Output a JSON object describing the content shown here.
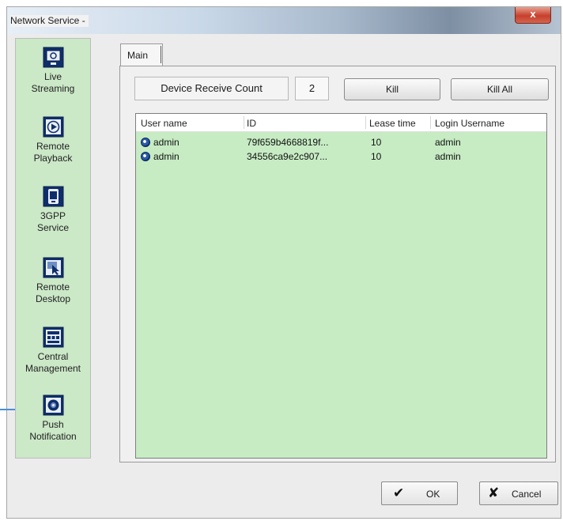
{
  "window": {
    "title": "Network Service -",
    "close_label": "x"
  },
  "sidebar": {
    "items": [
      {
        "label_1": "Live",
        "label_2": "Streaming",
        "icon": "monitor-icon"
      },
      {
        "label_1": "Remote",
        "label_2": "Playback",
        "icon": "play-icon"
      },
      {
        "label_1": "3GPP",
        "label_2": "Service",
        "icon": "phone-icon"
      },
      {
        "label_1": "Remote",
        "label_2": "Desktop",
        "icon": "desktop-cursor-icon"
      },
      {
        "label_1": "Central",
        "label_2": "Management",
        "icon": "management-icon"
      },
      {
        "label_1": "Push",
        "label_2": "Notification",
        "icon": "notification-icon"
      }
    ]
  },
  "tabs": {
    "main": "Main"
  },
  "main": {
    "count_label": "Device Receive Count",
    "count_value": "2",
    "kill_button": "Kill",
    "kill_all_button": "Kill All"
  },
  "table": {
    "columns": [
      "User name",
      "ID",
      "Lease time",
      "Login Username"
    ],
    "rows": [
      {
        "user": "admin",
        "id": "79f659b4668819f...",
        "lease": "10",
        "login": "admin"
      },
      {
        "user": "admin",
        "id": "34556ca9e2c907...",
        "lease": "10",
        "login": "admin"
      }
    ]
  },
  "footer": {
    "ok_label": "OK",
    "cancel_label": "Cancel"
  },
  "colors": {
    "panel_green": "#c7ecc4",
    "sidebar_green": "#cbe8c7",
    "callout_blue": "#4a8fd6"
  }
}
